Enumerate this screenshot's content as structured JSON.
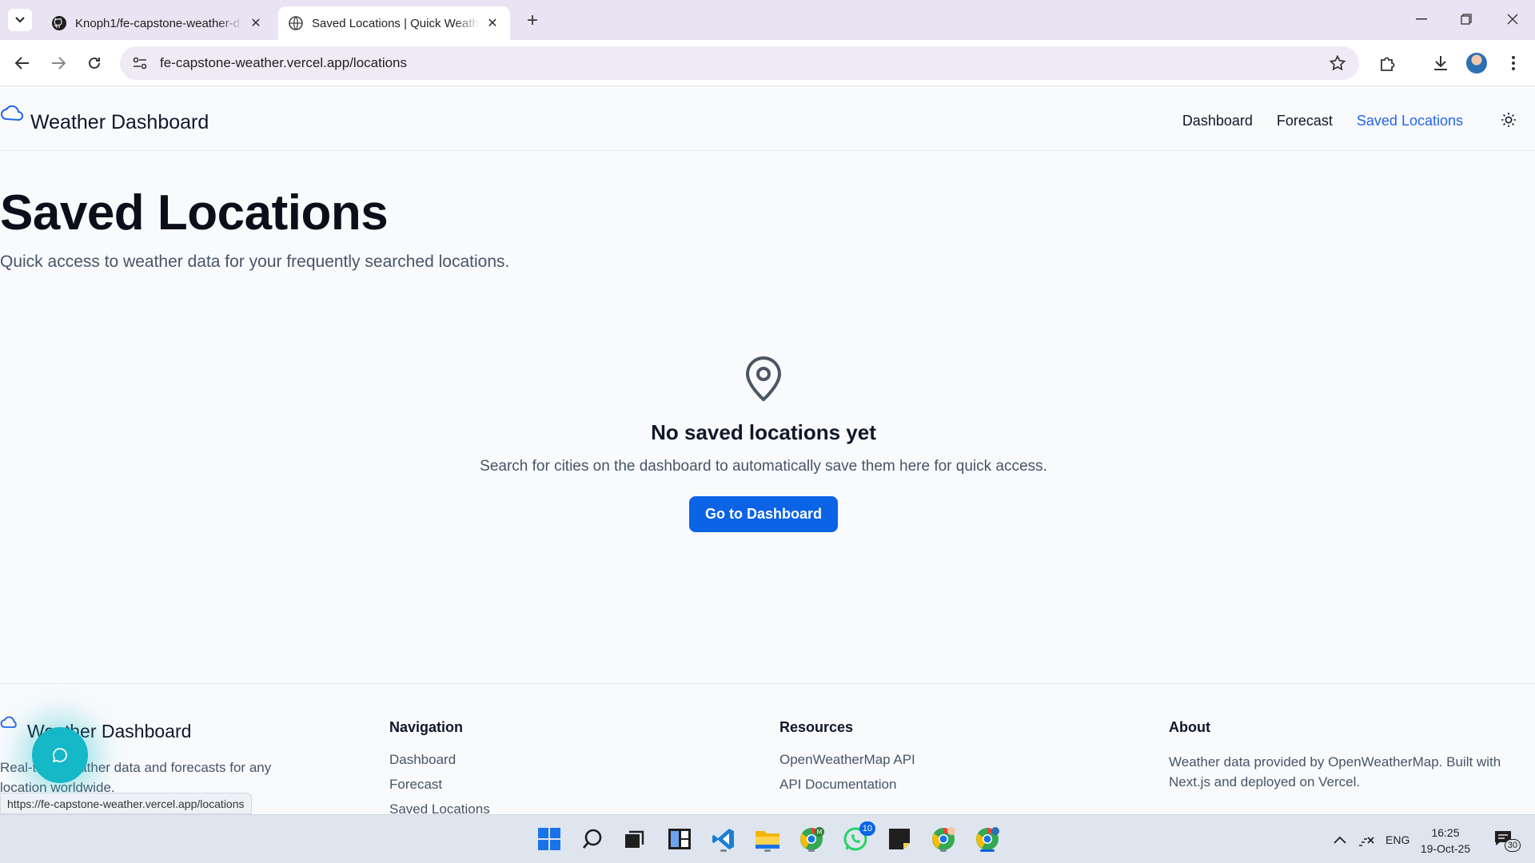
{
  "browser": {
    "tabs": [
      {
        "title": "Knoph1/fe-capstone-weather-d",
        "active": false,
        "icon": "github-icon"
      },
      {
        "title": "Saved Locations | Quick Weather",
        "active": true,
        "icon": "globe-icon"
      }
    ],
    "url": "fe-capstone-weather.vercel.app/locations",
    "status_url": "https://fe-capstone-weather.vercel.app/locations"
  },
  "header": {
    "brand": "Weather Dashboard",
    "nav": [
      {
        "label": "Dashboard",
        "active": false
      },
      {
        "label": "Forecast",
        "active": false
      },
      {
        "label": "Saved Locations",
        "active": true
      }
    ]
  },
  "main": {
    "title": "Saved Locations",
    "subtitle": "Quick access to weather data for your frequently searched locations.",
    "empty": {
      "title": "No saved locations yet",
      "description": "Search for cities on the dashboard to automatically save them here for quick access.",
      "button": "Go to Dashboard"
    }
  },
  "footer": {
    "brand": "Weather Dashboard",
    "description": "Real-time weather data and forecasts for any location worldwide.",
    "navigation": {
      "heading": "Navigation",
      "links": [
        "Dashboard",
        "Forecast",
        "Saved Locations"
      ]
    },
    "resources": {
      "heading": "Resources",
      "links": [
        "OpenWeatherMap API",
        "API Documentation"
      ]
    },
    "about": {
      "heading": "About",
      "text": "Weather data provided by OpenWeatherMap. Built with Next.js and deployed on Vercel."
    }
  },
  "taskbar": {
    "whatsapp_badge": "10",
    "language": "ENG",
    "time": "16:25",
    "date": "19-Oct-25",
    "notifications": "30"
  },
  "colors": {
    "accent": "#2563eb",
    "button": "#0b63e5",
    "chat_fab": "#14b8c7"
  }
}
